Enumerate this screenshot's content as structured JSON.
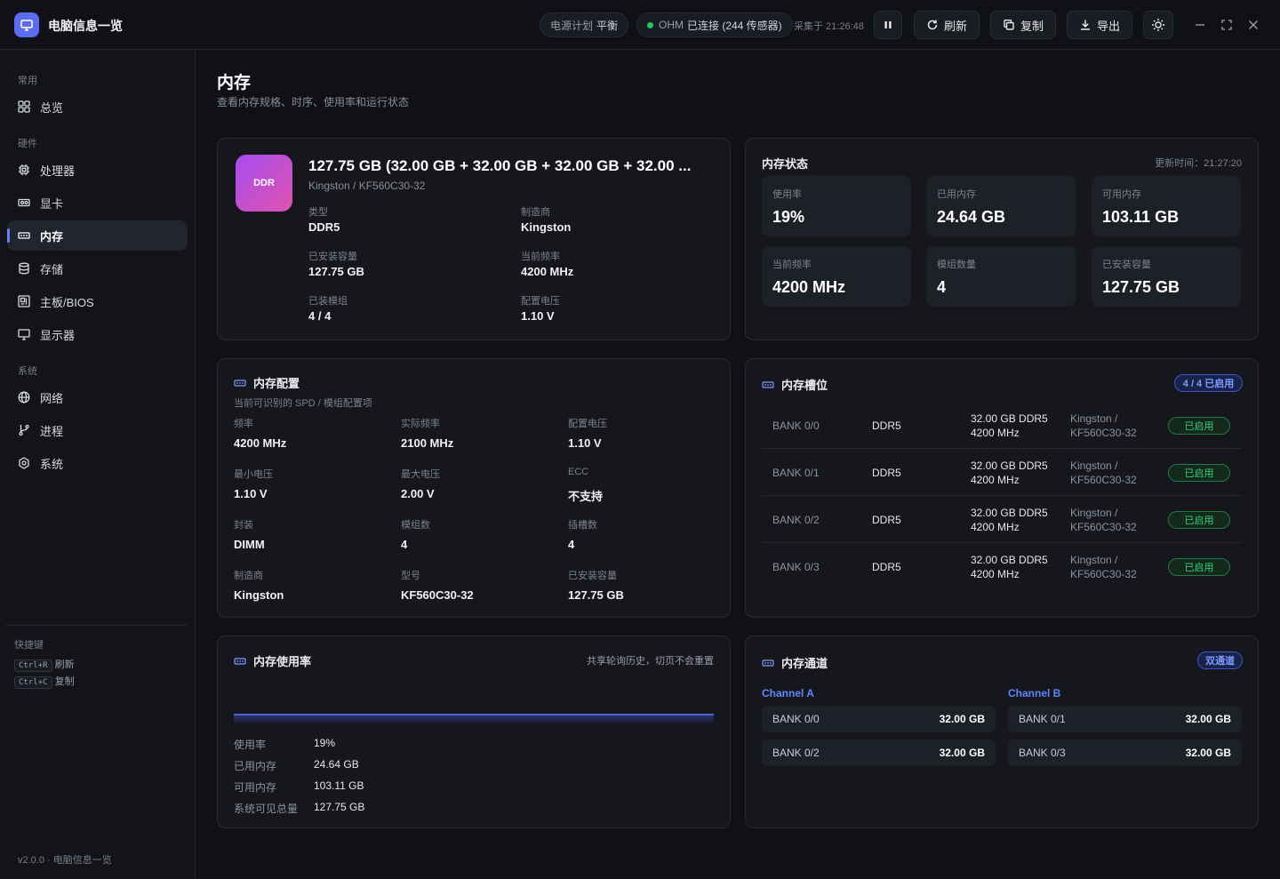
{
  "app": {
    "title": "电脑信息一览",
    "power_plan_label": "电源计划",
    "power_plan_value": "平衡",
    "ohm_label": "OHM",
    "ohm_status": "已连接 (244 传感器)",
    "collected": "采集于 21:26:48",
    "refresh": "刷新",
    "copy": "复制",
    "export": "导出"
  },
  "sidebar": {
    "sec_common": "常用",
    "sec_hardware": "硬件",
    "sec_system": "系统",
    "items": [
      "总览",
      "处理器",
      "显卡",
      "内存",
      "存储",
      "主板/BIOS",
      "显示器",
      "网络",
      "进程",
      "系统"
    ],
    "shortcuts_label": "快捷键",
    "shortcuts": [
      {
        "key": "Ctrl+R",
        "label": "刷新"
      },
      {
        "key": "Ctrl+C",
        "label": "复制"
      }
    ],
    "version": "v2.0.0 · 电脑信息一览"
  },
  "page": {
    "title": "内存",
    "subtitle": "查看内存规格、时序、使用率和运行状态"
  },
  "summary": {
    "badge": "DDR",
    "title": "127.75 GB (32.00 GB + 32.00 GB + 32.00 GB + 32.00 ...",
    "subtitle": "Kingston / KF560C30-32",
    "fields": [
      {
        "label": "类型",
        "value": "DDR5"
      },
      {
        "label": "制造商",
        "value": "Kingston"
      },
      {
        "label": "已安装容量",
        "value": "127.75 GB"
      },
      {
        "label": "当前频率",
        "value": "4200 MHz"
      },
      {
        "label": "已装模组",
        "value": "4 / 4"
      },
      {
        "label": "配置电压",
        "value": "1.10 V"
      }
    ]
  },
  "status": {
    "title": "内存状态",
    "updated": "更新时间：21:27:20",
    "tiles": [
      {
        "label": "使用率",
        "value": "19%"
      },
      {
        "label": "已用内存",
        "value": "24.64 GB"
      },
      {
        "label": "可用内存",
        "value": "103.11 GB"
      },
      {
        "label": "当前频率",
        "value": "4200 MHz"
      },
      {
        "label": "模组数量",
        "value": "4"
      },
      {
        "label": "已安装容量",
        "value": "127.75 GB"
      }
    ]
  },
  "config": {
    "title": "内存配置",
    "subtitle": "当前可识别的 SPD / 模组配置项",
    "fields": [
      {
        "label": "频率",
        "value": "4200 MHz"
      },
      {
        "label": "实际频率",
        "value": "2100 MHz"
      },
      {
        "label": "配置电压",
        "value": "1.10 V"
      },
      {
        "label": "最小电压",
        "value": "1.10 V"
      },
      {
        "label": "最大电压",
        "value": "2.00 V"
      },
      {
        "label": "ECC",
        "value": "不支持"
      },
      {
        "label": "封装",
        "value": "DIMM"
      },
      {
        "label": "模组数",
        "value": "4"
      },
      {
        "label": "插槽数",
        "value": "4"
      },
      {
        "label": "制造商",
        "value": "Kingston"
      },
      {
        "label": "型号",
        "value": "KF560C30-32"
      },
      {
        "label": "已安装容量",
        "value": "127.75 GB"
      }
    ]
  },
  "slots": {
    "title": "内存槽位",
    "badge": "4 / 4 已启用",
    "rows": [
      {
        "bank": "BANK 0/0",
        "type": "DDR5",
        "size": "32.00 GB DDR5",
        "freq": "4200 MHz",
        "vendor": "Kingston /",
        "model": "KF560C30-32",
        "state": "已启用"
      },
      {
        "bank": "BANK 0/1",
        "type": "DDR5",
        "size": "32.00 GB DDR5",
        "freq": "4200 MHz",
        "vendor": "Kingston /",
        "model": "KF560C30-32",
        "state": "已启用"
      },
      {
        "bank": "BANK 0/2",
        "type": "DDR5",
        "size": "32.00 GB DDR5",
        "freq": "4200 MHz",
        "vendor": "Kingston /",
        "model": "KF560C30-32",
        "state": "已启用"
      },
      {
        "bank": "BANK 0/3",
        "type": "DDR5",
        "size": "32.00 GB DDR5",
        "freq": "4200 MHz",
        "vendor": "Kingston /",
        "model": "KF560C30-32",
        "state": "已启用"
      }
    ]
  },
  "usage": {
    "title": "内存使用率",
    "note": "共享轮询历史，切页不会重置",
    "rows": [
      {
        "label": "使用率",
        "value": "19%"
      },
      {
        "label": "已用内存",
        "value": "24.64 GB"
      },
      {
        "label": "可用内存",
        "value": "103.11 GB"
      },
      {
        "label": "系统可见总量",
        "value": "127.75 GB"
      }
    ]
  },
  "channels": {
    "title": "内存通道",
    "badge": "双通道",
    "a_label": "Channel A",
    "b_label": "Channel B",
    "a": [
      {
        "bank": "BANK 0/0",
        "size": "32.00 GB"
      },
      {
        "bank": "BANK 0/2",
        "size": "32.00 GB"
      }
    ],
    "b": [
      {
        "bank": "BANK 0/1",
        "size": "32.00 GB"
      },
      {
        "bank": "BANK 0/3",
        "size": "32.00 GB"
      }
    ]
  }
}
